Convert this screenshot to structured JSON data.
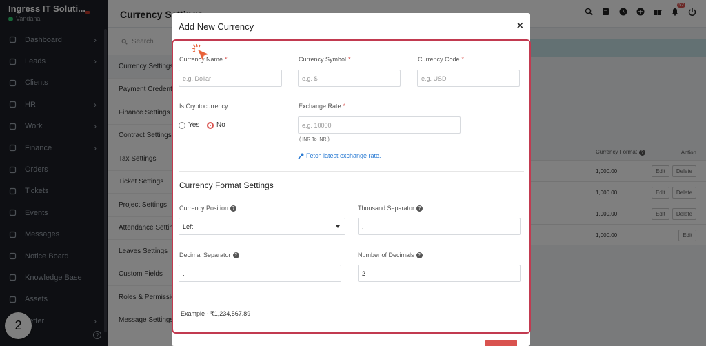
{
  "sidebar": {
    "brand": "Ingress IT Soluti...",
    "user": "Vandana",
    "items": [
      {
        "label": "Dashboard",
        "icon": "home-icon",
        "arrow": true
      },
      {
        "label": "Leads",
        "icon": "id-card-icon",
        "arrow": true
      },
      {
        "label": "Clients",
        "icon": "chart-icon",
        "arrow": false
      },
      {
        "label": "HR",
        "icon": "users-icon",
        "arrow": true
      },
      {
        "label": "Work",
        "icon": "briefcase-icon",
        "arrow": true
      },
      {
        "label": "Finance",
        "icon": "dollar-icon",
        "arrow": true
      },
      {
        "label": "Orders",
        "icon": "cart-icon",
        "arrow": false
      },
      {
        "label": "Tickets",
        "icon": "headset-icon",
        "arrow": false
      },
      {
        "label": "Events",
        "icon": "calendar-icon",
        "arrow": false
      },
      {
        "label": "Messages",
        "icon": "message-icon",
        "arrow": false
      },
      {
        "label": "Notice Board",
        "icon": "notice-icon",
        "arrow": false
      },
      {
        "label": "Knowledge Base",
        "icon": "book-icon",
        "arrow": false
      },
      {
        "label": "Assets",
        "icon": "monitor-icon",
        "arrow": false
      },
      {
        "label": "Letter",
        "icon": "letter-icon",
        "arrow": true
      }
    ],
    "step_badge": "2"
  },
  "topbar": {
    "title": "Currency Settings",
    "notification_count": "52"
  },
  "settings_menu": {
    "search_placeholder": "Search",
    "items": [
      "Currency Settings",
      "Payment Credentials",
      "Finance Settings",
      "Contract Settings",
      "Tax Settings",
      "Ticket Settings",
      "Project Settings",
      "Attendance Settings",
      "Leaves Settings",
      "Custom Fields",
      "Roles & Permissions",
      "Message Settings"
    ],
    "active_index": 0
  },
  "bg_table": {
    "col_format": "Currency Format",
    "col_action": "Action",
    "rows": [
      {
        "format": "1,000.00",
        "edit": "Edit",
        "delete": "Delete",
        "has_delete": true
      },
      {
        "format": "1,000.00",
        "edit": "Edit",
        "delete": "Delete",
        "has_delete": true
      },
      {
        "format": "1,000.00",
        "edit": "Edit",
        "delete": "Delete",
        "has_delete": true
      },
      {
        "format": "1,000.00",
        "edit": "Edit",
        "delete": "",
        "has_delete": false
      }
    ]
  },
  "modal": {
    "title": "Add New Currency",
    "close": "×",
    "currency_name": {
      "label": "Currency Name",
      "placeholder": "e.g. Dollar",
      "required": "*"
    },
    "currency_symbol": {
      "label": "Currency Symbol",
      "placeholder": "e.g. $",
      "required": "*"
    },
    "currency_code": {
      "label": "Currency Code",
      "placeholder": "e.g. USD",
      "required": "*"
    },
    "is_crypto": {
      "label": "Is Cryptocurrency",
      "yes": "Yes",
      "no": "No",
      "selected": "No"
    },
    "exchange_rate": {
      "label": "Exchange Rate",
      "placeholder": "e.g. 10000",
      "required": "*",
      "hint": "( INR To INR )",
      "fetch_link": "Fetch latest exchange rate."
    },
    "format_section_title": "Currency Format Settings",
    "currency_position": {
      "label": "Currency Position",
      "value": "Left"
    },
    "thousand_separator": {
      "label": "Thousand Separator",
      "value": ","
    },
    "decimal_separator": {
      "label": "Decimal Separator",
      "value": "."
    },
    "number_of_decimals": {
      "label": "Number of Decimals",
      "value": "2"
    },
    "example": "Example - ₹1,234,567.89"
  },
  "colors": {
    "accent": "#d9534f",
    "highlight_border": "#c23a50",
    "link": "#2a7bd3",
    "sidebar_bg": "#1d1f26"
  }
}
